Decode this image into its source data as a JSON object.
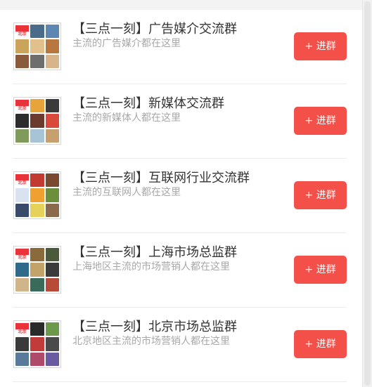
{
  "button_label": "+ 进群",
  "logo_text": "北京",
  "colors": {
    "accent": "#f25048",
    "title": "#333333",
    "subtitle": "#a8a8a8",
    "divider": "#ececec"
  },
  "groups": [
    {
      "title": "【三点一刻】广告媒介交流群",
      "description": "主流的广告媒介都在这里",
      "avatar_colors": [
        "logo",
        "#4a6b8a",
        "#5d86b3",
        "#c9a45a",
        "#e2c08b",
        "#b7773e",
        "#8b5a3c",
        "#6e6e6e",
        "#d7b48a"
      ]
    },
    {
      "title": "【三点一刻】新媒体交流群",
      "description": "主流的新媒体人都在这里",
      "avatar_colors": [
        "logo",
        "#e6a43a",
        "#3b3b3b",
        "#2d2d2d",
        "#6a3b2e",
        "#d94a3d",
        "#7f9a5a",
        "#a7c4d6",
        "#c8a070"
      ]
    },
    {
      "title": "【三点一刻】互联网行业交流群",
      "description": "主流的互联网人都在这里",
      "avatar_colors": [
        "logo",
        "#c23a32",
        "#7a4a30",
        "#d8e3ef",
        "#f0a030",
        "#6b8f3a",
        "#3a4a6a",
        "#e6d25a",
        "#8a6a4a"
      ]
    },
    {
      "title": "【三点一刻】上海市场总监群",
      "description": "上海地区主流的市场营销人都在这里",
      "avatar_colors": [
        "logo",
        "#8a6a3a",
        "#4a5a3a",
        "#2f6a8a",
        "#c2a36a",
        "#3b3b3b",
        "#d0b48a",
        "#3a6a5a",
        "#b84a3a"
      ]
    },
    {
      "title": "【三点一刻】北京市场总监群",
      "description": "北京地区主流的市场营销人都在这里",
      "avatar_colors": [
        "logo",
        "#2a2a2a",
        "#6a9a4a",
        "#3a3a3a",
        "#c23a3a",
        "#4a4a4a",
        "#5a7a9a",
        "#b04a6a",
        "#6a5aa0"
      ]
    }
  ]
}
